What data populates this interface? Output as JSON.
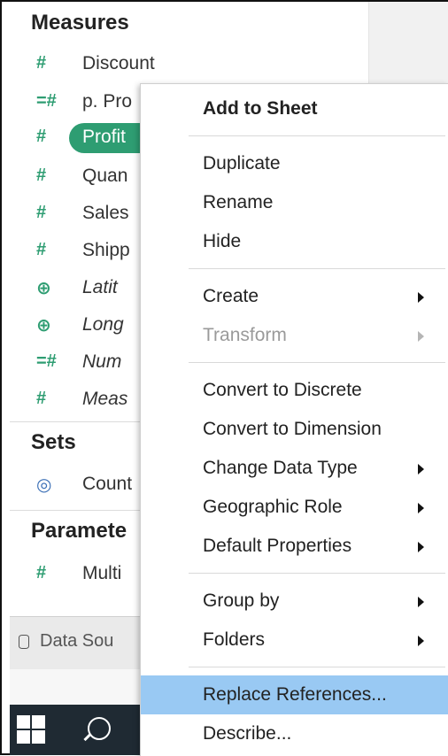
{
  "panel": {
    "measures_title": "Measures",
    "sets_title": "Sets",
    "parameters_title": "Paramete",
    "measures": [
      {
        "icon": "#",
        "icon_name": "number-icon",
        "label": "Discount",
        "italic": false
      },
      {
        "icon": "=#",
        "icon_name": "calculated-number-icon",
        "label": "p. Pro",
        "italic": false
      },
      {
        "icon": "#",
        "icon_name": "number-icon",
        "label": "Profit",
        "italic": false,
        "selected": true
      },
      {
        "icon": "#",
        "icon_name": "number-icon",
        "label": "Quan",
        "italic": false
      },
      {
        "icon": "#",
        "icon_name": "number-icon",
        "label": "Sales",
        "italic": false
      },
      {
        "icon": "#",
        "icon_name": "number-icon",
        "label": "Shipp",
        "italic": false
      },
      {
        "icon": "⊕",
        "icon_name": "globe-icon",
        "label": "Latit",
        "italic": true
      },
      {
        "icon": "⊕",
        "icon_name": "globe-icon",
        "label": "Long",
        "italic": true
      },
      {
        "icon": "=#",
        "icon_name": "calculated-number-icon",
        "label": "Num",
        "italic": true
      },
      {
        "icon": "#",
        "icon_name": "number-icon",
        "label": "Meas",
        "italic": true
      }
    ],
    "sets": [
      {
        "icon": "◎",
        "icon_name": "set-icon",
        "label": "Count"
      }
    ],
    "parameters": [
      {
        "icon": "#",
        "icon_name": "number-icon",
        "label": "Multi"
      }
    ],
    "data_source_tab": "Data Sou"
  },
  "menu": {
    "items": [
      {
        "label": "Add to Sheet",
        "bold": true
      },
      {
        "label": "Duplicate"
      },
      {
        "label": "Rename"
      },
      {
        "label": "Hide"
      },
      {
        "label": "Create",
        "submenu": true
      },
      {
        "label": "Transform",
        "submenu": true,
        "disabled": true
      },
      {
        "label": "Convert to Discrete"
      },
      {
        "label": "Convert to Dimension"
      },
      {
        "label": "Change Data Type",
        "submenu": true
      },
      {
        "label": "Geographic Role",
        "submenu": true
      },
      {
        "label": "Default Properties",
        "submenu": true
      },
      {
        "label": "Group by",
        "submenu": true
      },
      {
        "label": "Folders",
        "submenu": true
      },
      {
        "label": "Replace References...",
        "highlighted": true
      },
      {
        "label": "Describe..."
      }
    ]
  },
  "colors": {
    "accent_green": "#2e9d72",
    "highlight_blue": "#99c9f3",
    "taskbar": "#1f2a33"
  }
}
